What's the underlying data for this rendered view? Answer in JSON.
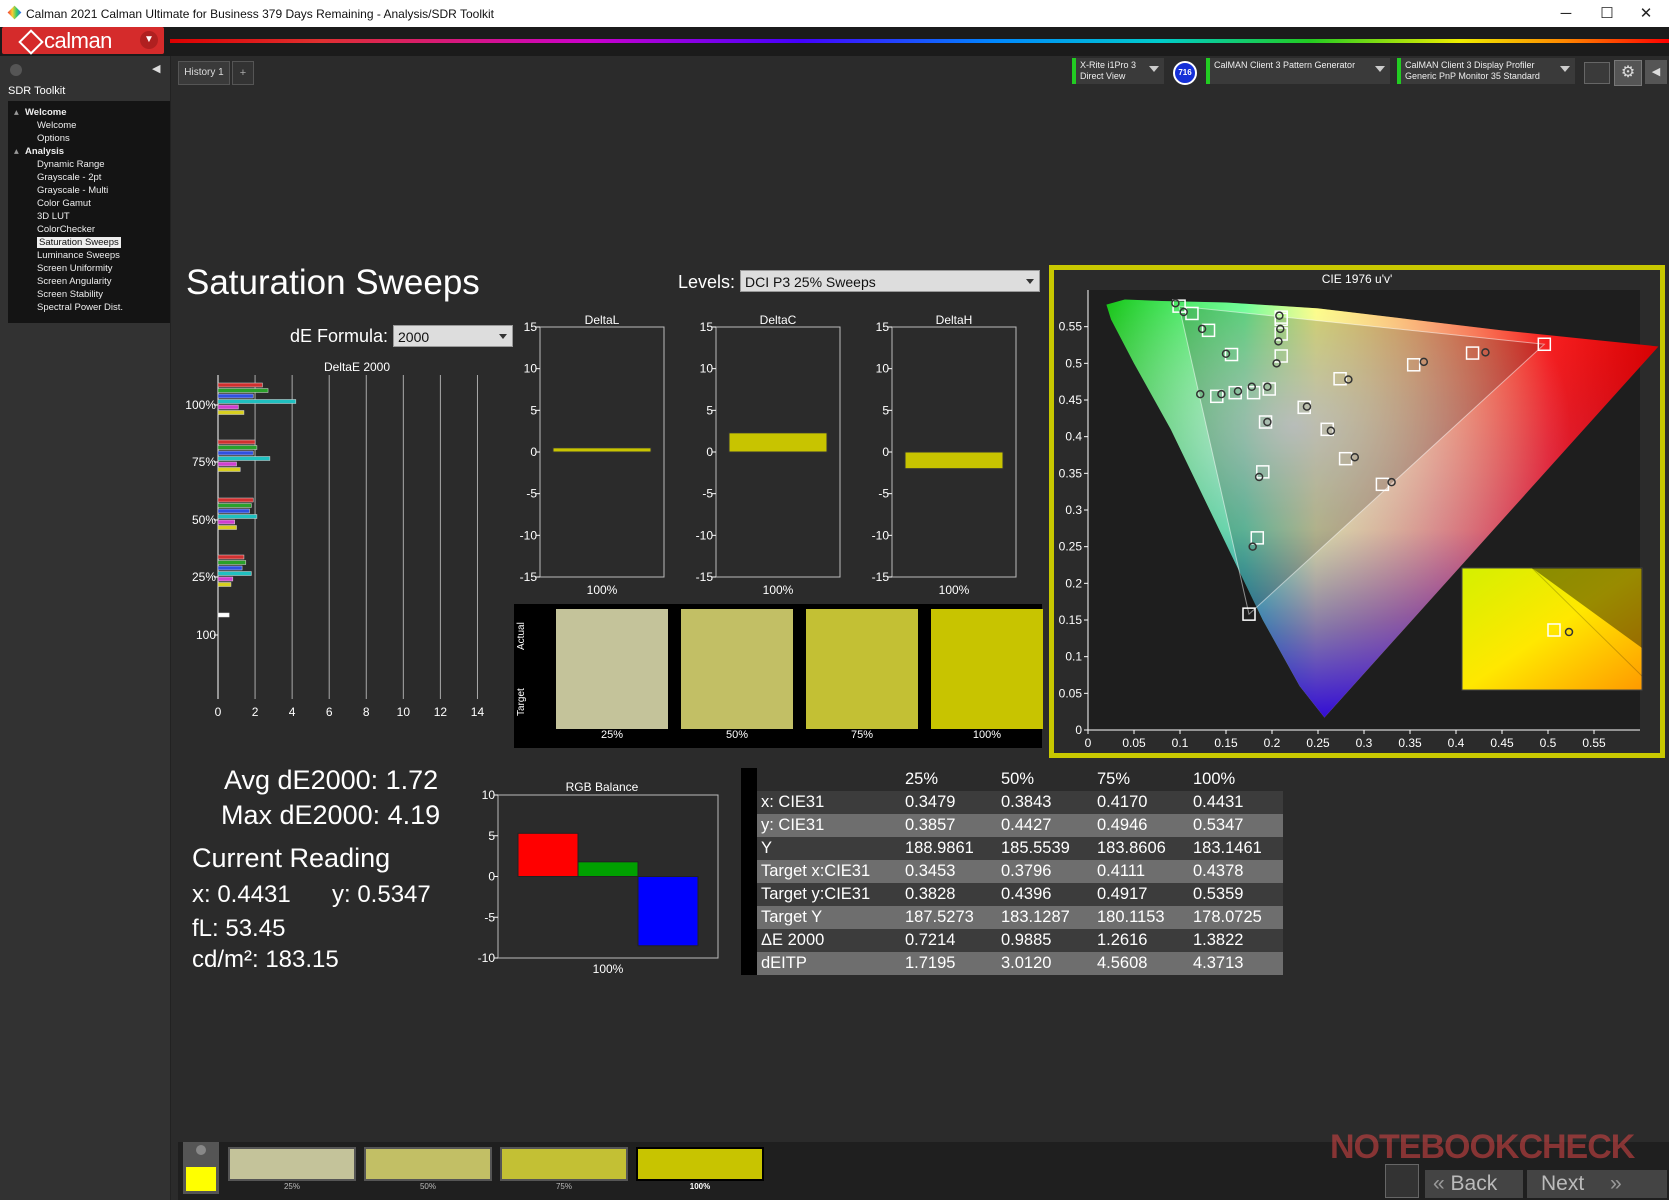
{
  "window": {
    "title": "Calman 2021 Calman Ultimate for Business 379 Days Remaining  - Analysis/SDR Toolkit",
    "minimize": "─",
    "maximize": "☐",
    "close": "✕"
  },
  "brand": {
    "logo_text": "calman",
    "accent": "#d52b2b"
  },
  "sidebar": {
    "section_title": "SDR Toolkit",
    "groups": [
      {
        "label": "Welcome",
        "items": [
          "Welcome",
          "Options"
        ]
      },
      {
        "label": "Analysis",
        "items": [
          "Dynamic Range",
          "Grayscale - 2pt",
          "Grayscale - Multi",
          "Color Gamut",
          "3D LUT",
          "ColorChecker",
          "Saturation Sweeps",
          "Luminance Sweeps",
          "Screen Uniformity",
          "Screen Angularity",
          "Screen Stability",
          "Spectral Power Dist."
        ]
      }
    ],
    "selected": "Saturation Sweeps"
  },
  "tabs": {
    "history": "History 1",
    "add": "+"
  },
  "devices": {
    "meter_line1": "X-Rite i1Pro 3",
    "meter_line2": "Direct View",
    "badge": "716",
    "pattern": "CalMAN Client 3 Pattern Generator",
    "display_line1": "CalMAN Client 3 Display Profiler",
    "display_line2": "Generic PnP Monitor 35 Standard"
  },
  "page": {
    "title": "Saturation Sweeps",
    "levels_label": "Levels:",
    "levels_value": "DCI P3 25% Sweeps",
    "de_formula_label": "dE Formula:",
    "de_formula_value": "2000"
  },
  "stats": {
    "avg": "Avg dE2000: 1.72",
    "max": "Max dE2000: 4.19",
    "current_reading": "Current Reading",
    "x": "x: 0.4431",
    "y": "y: 0.5347",
    "fl": "fL: 53.45",
    "cdm2": "cd/m²: 183.15"
  },
  "swatch_panel": {
    "actual_label": "Actual",
    "target_label": "Target",
    "labels": [
      "25%",
      "50%",
      "75%",
      "100%"
    ],
    "colors": [
      "#c4c39a",
      "#c2bf65",
      "#c3c034",
      "#c8c400"
    ]
  },
  "table": {
    "headers": [
      "",
      "25%",
      "50%",
      "75%",
      "100%"
    ],
    "rows": [
      [
        "x: CIE31",
        "0.3479",
        "0.3843",
        "0.4170",
        "0.4431"
      ],
      [
        "y: CIE31",
        "0.3857",
        "0.4427",
        "0.4946",
        "0.5347"
      ],
      [
        "Y",
        "188.9861",
        "185.5539",
        "183.8606",
        "183.1461"
      ],
      [
        "Target x:CIE31",
        "0.3453",
        "0.3796",
        "0.4111",
        "0.4378"
      ],
      [
        "Target y:CIE31",
        "0.3828",
        "0.4396",
        "0.4917",
        "0.5359"
      ],
      [
        "Target Y",
        "187.5273",
        "183.1287",
        "180.1153",
        "178.0725"
      ],
      [
        "ΔE 2000",
        "0.7214",
        "0.9885",
        "1.2616",
        "1.3822"
      ],
      [
        "dEITP",
        "1.7195",
        "3.0120",
        "4.5608",
        "4.3713"
      ]
    ]
  },
  "bottom": {
    "labels": [
      "25%",
      "50%",
      "75%",
      "100%"
    ],
    "colors": [
      "#c4c39a",
      "#c2bf65",
      "#c3c034",
      "#c8c400"
    ],
    "current_color": "#ffff00",
    "back": "Back",
    "next": "Next"
  },
  "watermark": "NOTEBOOKCHECK",
  "chart_data": [
    {
      "type": "bar",
      "title": "DeltaE 2000",
      "orientation": "horizontal",
      "categories": [
        "100%",
        "75%",
        "50%",
        "25%",
        "100"
      ],
      "xticks": [
        0,
        2,
        4,
        6,
        8,
        10,
        12,
        14
      ],
      "xlim": [
        0,
        15
      ],
      "series": [
        {
          "color": "#d03030",
          "values": [
            2.4,
            2.0,
            1.9,
            1.4,
            0
          ]
        },
        {
          "color": "#2aa02a",
          "values": [
            2.7,
            2.1,
            1.8,
            1.5,
            0
          ]
        },
        {
          "color": "#3050e0",
          "values": [
            1.9,
            1.9,
            1.7,
            1.3,
            0
          ]
        },
        {
          "color": "#20c0c0",
          "values": [
            4.2,
            2.8,
            2.1,
            1.8,
            0
          ]
        },
        {
          "color": "#d040d0",
          "values": [
            1.1,
            1.0,
            0.9,
            0.8,
            0
          ]
        },
        {
          "color": "#d8d020",
          "values": [
            1.4,
            1.2,
            1.0,
            0.7,
            0
          ]
        },
        {
          "color": "#ffffff",
          "values": [
            0,
            0,
            0,
            0,
            0.6
          ]
        }
      ]
    },
    {
      "type": "bar",
      "title": "DeltaL",
      "categories": [
        "100%"
      ],
      "values": [
        0.5
      ],
      "ylim": [
        -15,
        15
      ],
      "yticks": [
        15,
        10,
        5,
        0,
        -5,
        -10,
        -15
      ]
    },
    {
      "type": "bar",
      "title": "DeltaC",
      "categories": [
        "100%"
      ],
      "values": [
        2.3
      ],
      "ylim": [
        -15,
        15
      ],
      "yticks": [
        15,
        10,
        5,
        0,
        -5,
        -10,
        -15
      ]
    },
    {
      "type": "bar",
      "title": "DeltaH",
      "categories": [
        "100%"
      ],
      "values": [
        -2.0
      ],
      "ylim": [
        -15,
        15
      ],
      "yticks": [
        15,
        10,
        5,
        0,
        -5,
        -10,
        -15
      ]
    },
    {
      "type": "bar",
      "title": "RGB Balance",
      "categories": [
        "100%"
      ],
      "series": [
        {
          "name": "R",
          "color": "#ff0000",
          "values": [
            5.3
          ]
        },
        {
          "name": "G",
          "color": "#00a000",
          "values": [
            1.8
          ]
        },
        {
          "name": "B",
          "color": "#0000ff",
          "values": [
            -8.5
          ]
        }
      ],
      "ylim": [
        -10,
        10
      ],
      "yticks": [
        10,
        5,
        0,
        -5,
        -10
      ]
    },
    {
      "type": "scatter",
      "title": "CIE 1976 u'v'",
      "xlim": [
        0,
        0.6
      ],
      "ylim": [
        0,
        0.6
      ],
      "xticks": [
        0,
        0.05,
        0.1,
        0.15,
        0.2,
        0.25,
        0.3,
        0.35,
        0.4,
        0.45,
        0.5,
        0.55
      ],
      "yticks": [
        0,
        0.05,
        0.1,
        0.15,
        0.2,
        0.25,
        0.3,
        0.35,
        0.4,
        0.45,
        0.5,
        0.55
      ],
      "gamut_triangle": [
        [
          0.496,
          0.526
        ],
        [
          0.099,
          0.578
        ],
        [
          0.175,
          0.158
        ]
      ],
      "targets": [
        [
          0.496,
          0.526
        ],
        [
          0.418,
          0.514
        ],
        [
          0.354,
          0.498
        ],
        [
          0.274,
          0.479
        ],
        [
          0.099,
          0.578
        ],
        [
          0.113,
          0.568
        ],
        [
          0.131,
          0.545
        ],
        [
          0.156,
          0.512
        ],
        [
          0.175,
          0.158
        ],
        [
          0.184,
          0.262
        ],
        [
          0.19,
          0.352
        ],
        [
          0.193,
          0.42
        ],
        [
          0.21,
          0.563
        ],
        [
          0.21,
          0.56
        ],
        [
          0.21,
          0.54
        ],
        [
          0.21,
          0.51
        ],
        [
          0.197,
          0.465
        ],
        [
          0.18,
          0.46
        ],
        [
          0.16,
          0.46
        ],
        [
          0.14,
          0.455
        ],
        [
          0.235,
          0.44
        ],
        [
          0.26,
          0.41
        ],
        [
          0.28,
          0.37
        ],
        [
          0.32,
          0.335
        ]
      ],
      "measured": [
        [
          0.432,
          0.515
        ],
        [
          0.365,
          0.502
        ],
        [
          0.283,
          0.478
        ],
        [
          0.095,
          0.582
        ],
        [
          0.104,
          0.57
        ],
        [
          0.124,
          0.547
        ],
        [
          0.15,
          0.513
        ],
        [
          0.179,
          0.25
        ],
        [
          0.186,
          0.345
        ],
        [
          0.195,
          0.42
        ],
        [
          0.208,
          0.565
        ],
        [
          0.209,
          0.547
        ],
        [
          0.207,
          0.53
        ],
        [
          0.205,
          0.5
        ],
        [
          0.195,
          0.468
        ],
        [
          0.178,
          0.468
        ],
        [
          0.163,
          0.462
        ],
        [
          0.145,
          0.458
        ],
        [
          0.122,
          0.458
        ],
        [
          0.238,
          0.441
        ],
        [
          0.264,
          0.408
        ],
        [
          0.29,
          0.372
        ],
        [
          0.33,
          0.338
        ]
      ]
    }
  ]
}
